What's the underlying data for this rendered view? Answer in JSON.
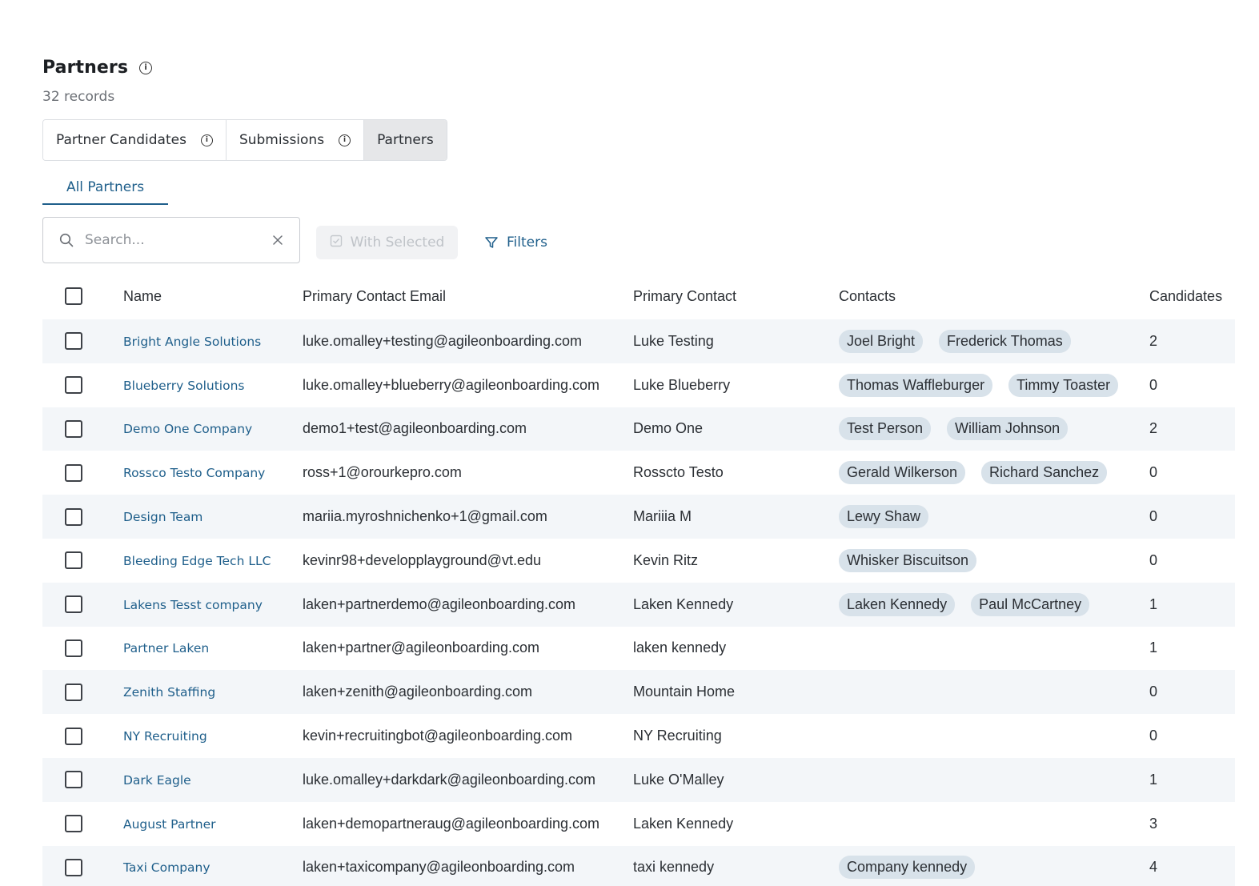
{
  "page": {
    "title": "Partners",
    "record_count": "32 records"
  },
  "segments": [
    {
      "label": "Partner Candidates",
      "has_info": true
    },
    {
      "label": "Submissions",
      "has_info": true
    },
    {
      "label": "Partners",
      "has_info": false,
      "active": true
    }
  ],
  "subtab": {
    "label": "All Partners"
  },
  "toolbar": {
    "search_placeholder": "Search...",
    "with_selected_label": "With Selected",
    "filters_label": "Filters"
  },
  "colors": {
    "accent": "#1f5f8b",
    "chip_bg": "#d8e2ea",
    "row_stripe": "#f3f6f9"
  },
  "table": {
    "columns": [
      "Name",
      "Primary Contact Email",
      "Primary Contact",
      "Contacts",
      "Candidates"
    ],
    "rows": [
      {
        "name": "Bright Angle Solutions",
        "email": "luke.omalley+testing@agileonboarding.com",
        "primary": "Luke Testing",
        "contacts": [
          "Joel Bright",
          "Frederick Thomas"
        ],
        "candidates": "2"
      },
      {
        "name": "Blueberry Solutions",
        "email": "luke.omalley+blueberry@agileonboarding.com",
        "primary": "Luke Blueberry",
        "contacts": [
          "Thomas Waffleburger",
          "Timmy Toaster"
        ],
        "candidates": "0"
      },
      {
        "name": "Demo One Company",
        "email": "demo1+test@agileonboarding.com",
        "primary": "Demo One",
        "contacts": [
          "Test Person",
          "William Johnson"
        ],
        "candidates": "2"
      },
      {
        "name": "Rossco Testo Company",
        "email": "ross+1@orourkepro.com",
        "primary": "Rosscto Testo",
        "contacts": [
          "Gerald Wilkerson",
          "Richard Sanchez"
        ],
        "candidates": "0"
      },
      {
        "name": "Design Team",
        "email": "mariia.myroshnichenko+1@gmail.com",
        "primary": "Mariiia M",
        "contacts": [
          "Lewy Shaw"
        ],
        "candidates": "0"
      },
      {
        "name": "Bleeding Edge Tech LLC",
        "email": "kevinr98+developplayground@vt.edu",
        "primary": "Kevin Ritz",
        "contacts": [
          "Whisker Biscuitson"
        ],
        "candidates": "0"
      },
      {
        "name": "Lakens Tesst company",
        "email": "laken+partnerdemo@agileonboarding.com",
        "primary": "Laken Kennedy",
        "contacts": [
          "Laken Kennedy",
          "Paul McCartney"
        ],
        "candidates": "1"
      },
      {
        "name": "Partner Laken",
        "email": "laken+partner@agileonboarding.com",
        "primary": "laken kennedy",
        "contacts": [],
        "candidates": "1"
      },
      {
        "name": "Zenith Staffing",
        "email": "laken+zenith@agileonboarding.com",
        "primary": "Mountain Home",
        "contacts": [],
        "candidates": "0"
      },
      {
        "name": "NY Recruiting",
        "email": "kevin+recruitingbot@agileonboarding.com",
        "primary": "NY Recruiting",
        "contacts": [],
        "candidates": "0"
      },
      {
        "name": "Dark Eagle",
        "email": "luke.omalley+darkdark@agileonboarding.com",
        "primary": "Luke O'Malley",
        "contacts": [],
        "candidates": "1"
      },
      {
        "name": "August Partner",
        "email": "laken+demopartneraug@agileonboarding.com",
        "primary": "Laken Kennedy",
        "contacts": [],
        "candidates": "3"
      },
      {
        "name": "Taxi Company",
        "email": "laken+taxicompany@agileonboarding.com",
        "primary": "taxi kennedy",
        "contacts": [
          "Company kennedy"
        ],
        "candidates": "4"
      }
    ]
  }
}
